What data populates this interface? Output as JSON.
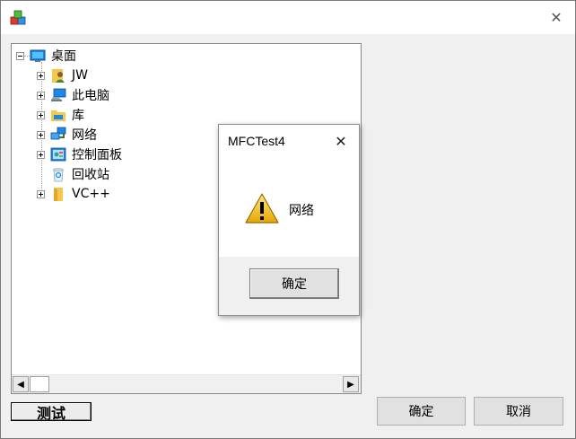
{
  "window": {
    "close_glyph": "✕"
  },
  "tree": {
    "root": {
      "label": "桌面",
      "icon": "desktop-icon",
      "expanded": true
    },
    "items": [
      {
        "label": "JW",
        "icon": "user-folder-icon",
        "expandable": true
      },
      {
        "label": "此电脑",
        "icon": "computer-icon",
        "expandable": true
      },
      {
        "label": "库",
        "icon": "library-icon",
        "expandable": true
      },
      {
        "label": "网络",
        "icon": "network-icon",
        "expandable": true
      },
      {
        "label": "控制面板",
        "icon": "control-panel-icon",
        "expandable": true
      },
      {
        "label": "回收站",
        "icon": "recycle-bin-icon",
        "expandable": false
      },
      {
        "label": "VC++",
        "icon": "folder-icon",
        "expandable": true
      }
    ]
  },
  "scrollbar": {
    "left_arrow": "◀",
    "right_arrow": "▶"
  },
  "buttons": {
    "test_label": "测试",
    "ok_label": "确定",
    "cancel_label": "取消"
  },
  "message_box": {
    "title": "MFCTest4",
    "close_glyph": "✕",
    "message": "网络",
    "ok_label": "确定",
    "icon": "warning-icon"
  }
}
